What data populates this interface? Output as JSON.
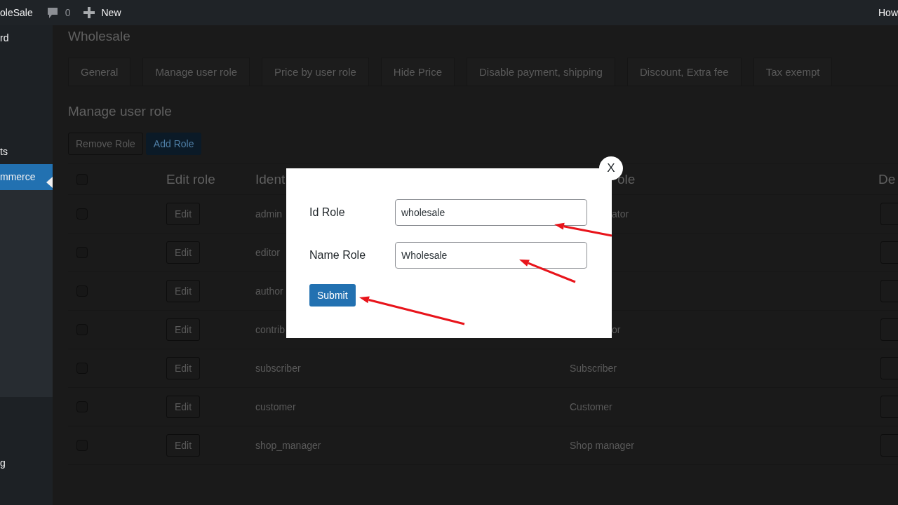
{
  "admin_bar": {
    "site_name": "oleSale",
    "comments_count": "0",
    "new_label": "New",
    "account_label": "How"
  },
  "sidebar": {
    "items": [
      {
        "label": "rd",
        "selected": false
      },
      {
        "label": "ts",
        "selected": false
      },
      {
        "label": "mmerce",
        "selected": true
      },
      {
        "label": "g",
        "selected": false
      }
    ]
  },
  "page": {
    "title": "Wholesale",
    "tabs": [
      {
        "label": "General"
      },
      {
        "label": "Manage user role"
      },
      {
        "label": "Price by user role"
      },
      {
        "label": "Hide Price"
      },
      {
        "label": "Disable payment, shipping"
      },
      {
        "label": "Discount, Extra fee"
      },
      {
        "label": "Tax exempt"
      }
    ],
    "section_title": "Manage user role",
    "buttons": [
      {
        "label": "Remove Role",
        "kind": "secondary"
      },
      {
        "label": "Add Role",
        "kind": "primary"
      }
    ]
  },
  "table": {
    "columns": [
      {
        "kind": "checkbox",
        "checked": false
      },
      {
        "kind": "text",
        "label": "Edit role"
      },
      {
        "kind": "text",
        "label": "Ident"
      },
      {
        "kind": "text",
        "label": "ole"
      },
      {
        "kind": "text",
        "label": "De"
      }
    ],
    "rows": [
      {
        "checked": false,
        "edit_button": "Edit",
        "column_3": "admin",
        "column_4": "ator"
      },
      {
        "checked": false,
        "edit_button": "Edit",
        "column_3": "editor"
      },
      {
        "checked": false,
        "edit_button": "Edit",
        "column_3": "author"
      },
      {
        "checked": false,
        "edit_button": "Edit",
        "column_3": "contrib",
        "column_4": "or"
      },
      {
        "checked": false,
        "edit_button": "Edit",
        "column_3": "subscriber",
        "column_4": "Subscriber"
      },
      {
        "checked": false,
        "edit_button": "Edit",
        "column_3": "customer",
        "column_4": "Customer"
      },
      {
        "checked": false,
        "edit_button": "Edit",
        "column_3": "shop_manager",
        "column_4": "Shop manager"
      }
    ]
  },
  "dialog": {
    "close_label": "X",
    "fields": [
      {
        "label": "Id Role",
        "value": "wholesale"
      },
      {
        "label": "Name Role",
        "value": "Wholesale"
      }
    ],
    "submit_label": "Submit"
  }
}
